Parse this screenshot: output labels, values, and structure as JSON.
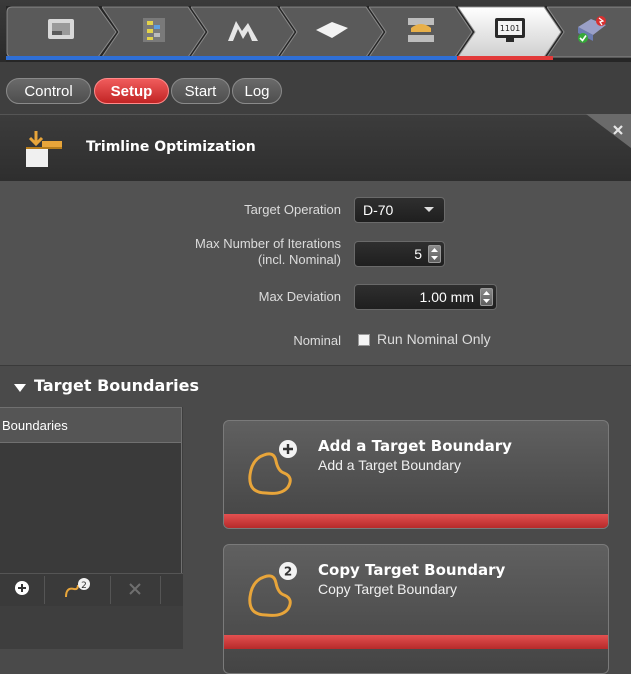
{
  "workflow": {
    "steps": [
      {
        "icon": "sheet-blank-icon"
      },
      {
        "icon": "blank-layout-icon"
      },
      {
        "icon": "die-shape-icon"
      },
      {
        "icon": "flat-sheet-icon"
      },
      {
        "icon": "forming-press-icon"
      },
      {
        "icon": "computer-monitor-icon",
        "label": "1101"
      },
      {
        "icon": "analysis-result-icon"
      }
    ],
    "colors": {
      "blue": "#2f6fd6",
      "red": "#e23a3a"
    }
  },
  "tabs": [
    {
      "label": "Control",
      "active": false
    },
    {
      "label": "Setup",
      "active": true
    },
    {
      "label": "Start",
      "active": false
    },
    {
      "label": "Log",
      "active": false
    }
  ],
  "panel": {
    "title": "Trimline Optimization",
    "icon": "trimline-optimization-icon",
    "close_icon": "close-icon"
  },
  "form": {
    "target_operation": {
      "label": "Target Operation",
      "value": "D-70"
    },
    "max_iterations": {
      "label_line1": "Max Number of Iterations",
      "label_line2": "(incl. Nominal)",
      "value": "5"
    },
    "max_deviation": {
      "label": "Max Deviation",
      "value": "1.00 mm"
    },
    "nominal": {
      "label": "Nominal",
      "checkbox_label": "Run Nominal Only",
      "checked": false
    }
  },
  "target_boundaries": {
    "section_title": "Target Boundaries",
    "list_header": "Boundaries",
    "toolbar": [
      "add-icon",
      "boundary-copy-icon",
      "delete-icon"
    ],
    "add_card": {
      "title": "Add a Target Boundary",
      "subtitle": "Add a Target Boundary",
      "icon": "boundary-add-icon"
    },
    "copy_card": {
      "title": "Copy Target Boundary",
      "subtitle": "Copy Target Boundary",
      "icon": "boundary-copy-icon"
    },
    "accent": "#d63c3c"
  }
}
